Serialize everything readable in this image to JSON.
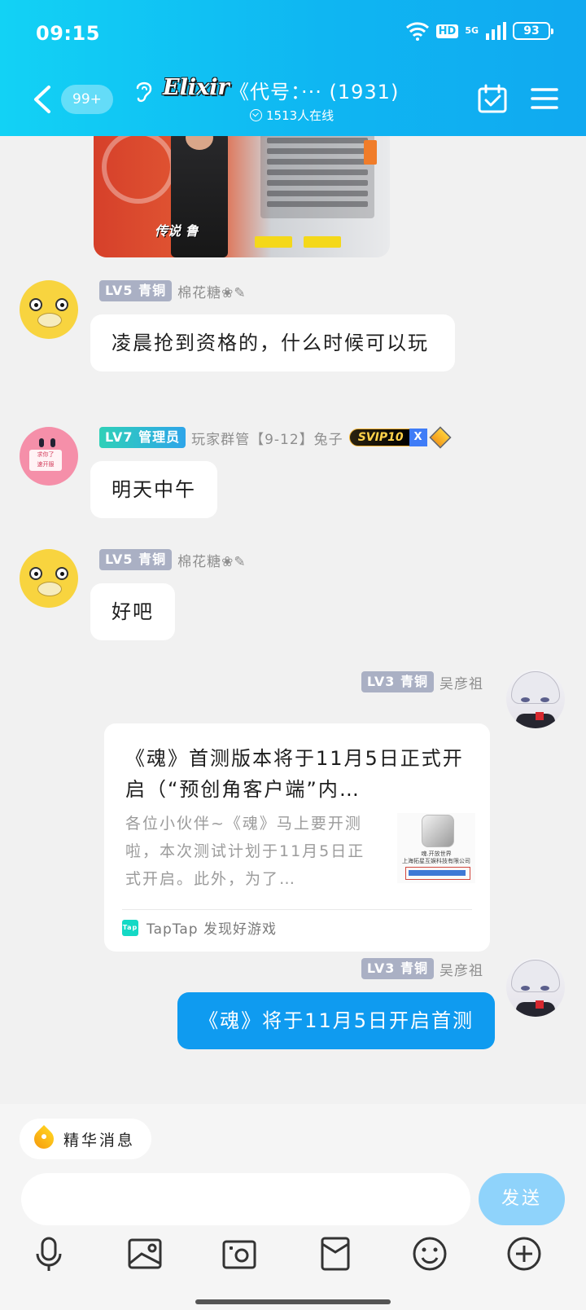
{
  "status_bar": {
    "time": "09:15",
    "hd": "HD",
    "network": "5G",
    "battery": "93"
  },
  "header": {
    "unread_badge": "99+",
    "group_logo_text": "Elixir",
    "title": "《代号：··· (1931)",
    "online_count": "1513人在线"
  },
  "messages": [
    {
      "type": "text",
      "side": "left",
      "level": "LV5 青铜",
      "user": "棉花糖❀✎",
      "text": "凌晨抢到资格的，什么时候可以玩"
    },
    {
      "type": "text",
      "side": "left",
      "level": "LV7 管理员",
      "user": "玩家群管【9-12】兔子",
      "vip": "SVIP10",
      "vip_extra": "X",
      "text": "明天中午"
    },
    {
      "type": "text",
      "side": "left",
      "level": "LV5 青铜",
      "user": "棉花糖❀✎",
      "text": "好吧"
    },
    {
      "type": "link_card",
      "side": "right",
      "level": "LV3 青铜",
      "user": "吴彦祖",
      "title": "《魂》首测版本将于11月5日正式开启（“预创角客户端”内…",
      "summary": "各位小伙伴~《魂》马上要开测啦，本次测试计划于11月5日正式开启。此外，为了…",
      "thumb_caption": "魂.开放世界\n上海拓星互娱科技有限公司",
      "source": "TapTap 发现好游戏",
      "source_icon": "Tap"
    },
    {
      "type": "text",
      "side": "right",
      "level": "LV3 青铜",
      "user": "吴彦祖",
      "text": "《魂》将于11月5日开启首测"
    }
  ],
  "screenshot_image": {
    "rarity_tag": "传说 鲁"
  },
  "bottom": {
    "essence_chip": "精华消息",
    "input_placeholder": "",
    "send_label": "发送",
    "tools": [
      "mic-icon",
      "image-icon",
      "camera-icon",
      "red-packet-icon",
      "emoji-icon",
      "plus-icon"
    ]
  },
  "colors": {
    "header_gradient_start": "#12d2f5",
    "header_gradient_end": "#10a9f0",
    "bubble_blue": "#0f9bf0",
    "send_button": "#8fd3fb",
    "level_badge": "#aab0c4"
  }
}
